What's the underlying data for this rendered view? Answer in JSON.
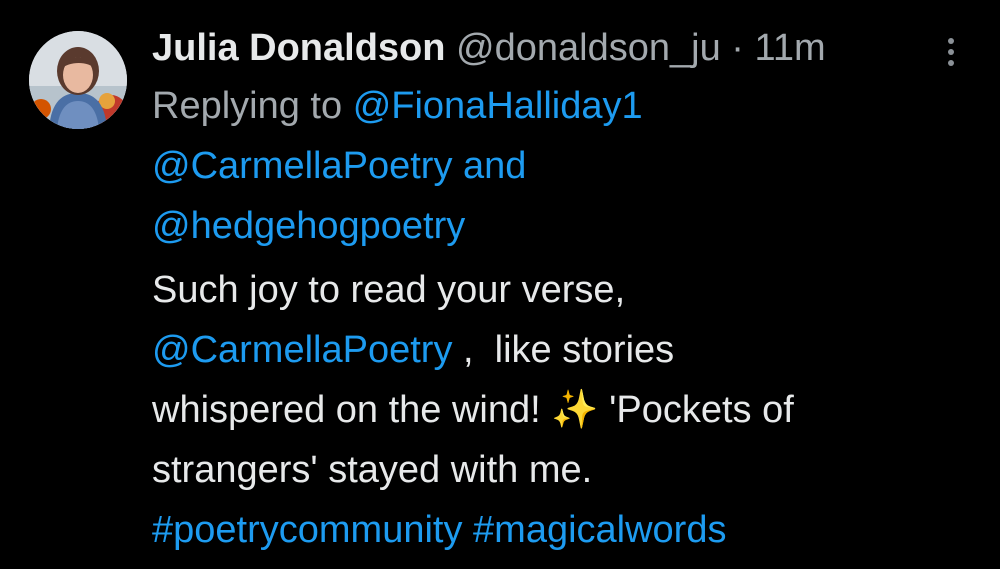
{
  "tweet": {
    "author_name": "Julia Donaldson",
    "author_handle": "@donaldson_ju",
    "separator": "·",
    "timestamp": "11m",
    "avatar_icon": "avatar-photo",
    "more_icon": "more-vertical-icon",
    "replying_to_label": "Replying to",
    "reply_mentions": [
      "@FionaHalliday1",
      "@CarmellaPoetry",
      "@hedgehogpoetry"
    ],
    "reply_conjunction": "and",
    "body": {
      "line1": "Such joy to read your verse,",
      "mention": "@CarmellaPoetry",
      "line2_rest": " ,  like stories",
      "line3": "whispered on the wind! ✨ 'Pockets of",
      "line4": "strangers' stayed with me.",
      "hashtags": [
        "#poetrycommunity",
        "#magicalwords"
      ]
    }
  },
  "colors": {
    "background": "#000000",
    "text_primary": "#e7e9ea",
    "text_secondary": "#a3a9ae",
    "link": "#1d9bf0"
  }
}
